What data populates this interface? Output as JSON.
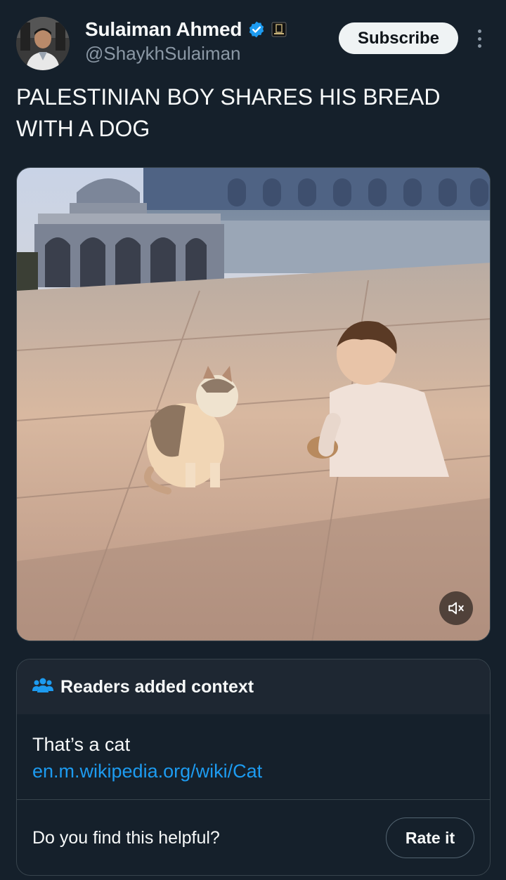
{
  "author": {
    "name": "Sulaiman Ahmed",
    "handle": "@ShaykhSulaiman",
    "verified_icon": "verified-badge-icon",
    "affiliation_icon": "affiliation-badge-icon"
  },
  "actions": {
    "subscribe_label": "Subscribe",
    "more_icon": "more-vertical-icon"
  },
  "post": {
    "text": "PALESTINIAN BOY SHARES HIS BREAD WITH A DOG"
  },
  "media": {
    "type": "video",
    "mute_icon": "speaker-muted-icon"
  },
  "community_note": {
    "header_icon": "people-icon",
    "header_title": "Readers added context",
    "note_text": "That’s a cat",
    "link_text": "en.m.wikipedia.org/wiki/Cat",
    "helpful_prompt": "Do you find this helpful?",
    "rate_label": "Rate it"
  },
  "colors": {
    "background": "#15202b",
    "accent_link": "#1d9bf0",
    "secondary_text": "#8b98a5",
    "verified": "#1d9bf0"
  }
}
